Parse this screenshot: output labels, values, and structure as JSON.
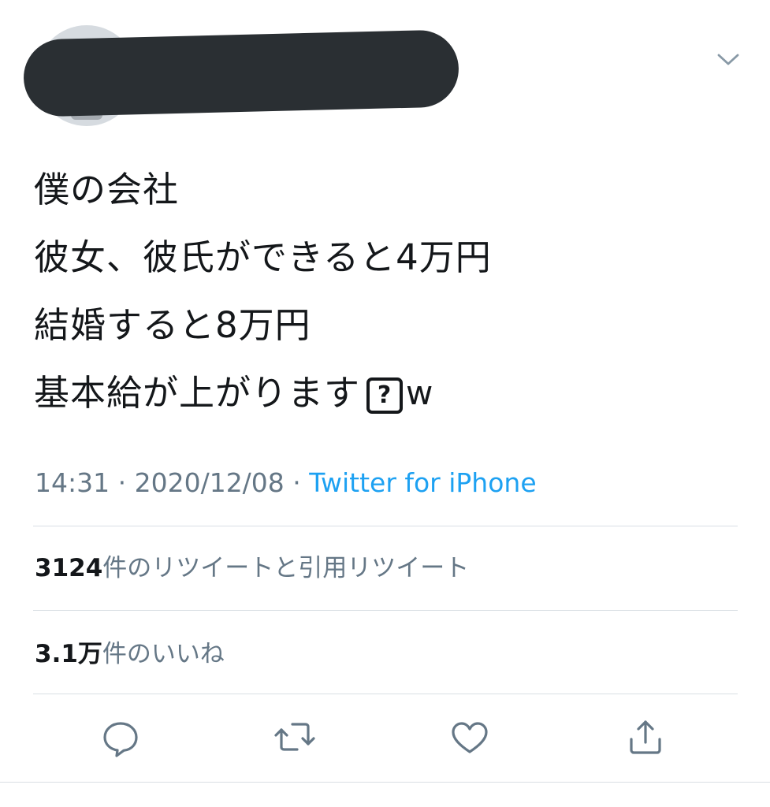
{
  "tweet": {
    "text_lines": [
      "僕の会社",
      "彼女、彼氏ができると4万円",
      "結婚すると8万円",
      "基本給が上がります"
    ],
    "emoji_placeholder": "?",
    "suffix": "w",
    "meta": {
      "time": "14:31",
      "separator": " · ",
      "date": "2020/12/08",
      "separator2": " · ",
      "source": "Twitter for iPhone"
    },
    "stats": {
      "retweets_count": "3124",
      "retweets_label": "件のリツイートと引用リツイート",
      "likes_count": "3.1万",
      "likes_label": "件のいいね"
    }
  },
  "icons": {
    "caret": "chevron-down-icon",
    "reply": "reply-icon",
    "retweet": "retweet-icon",
    "like": "heart-icon",
    "share": "share-icon"
  },
  "colors": {
    "text": "#14171a",
    "secondary": "#657786",
    "link": "#1da1f2",
    "divider": "#d9dfe4",
    "redaction": "#2a2f33",
    "icon": "#657786"
  }
}
